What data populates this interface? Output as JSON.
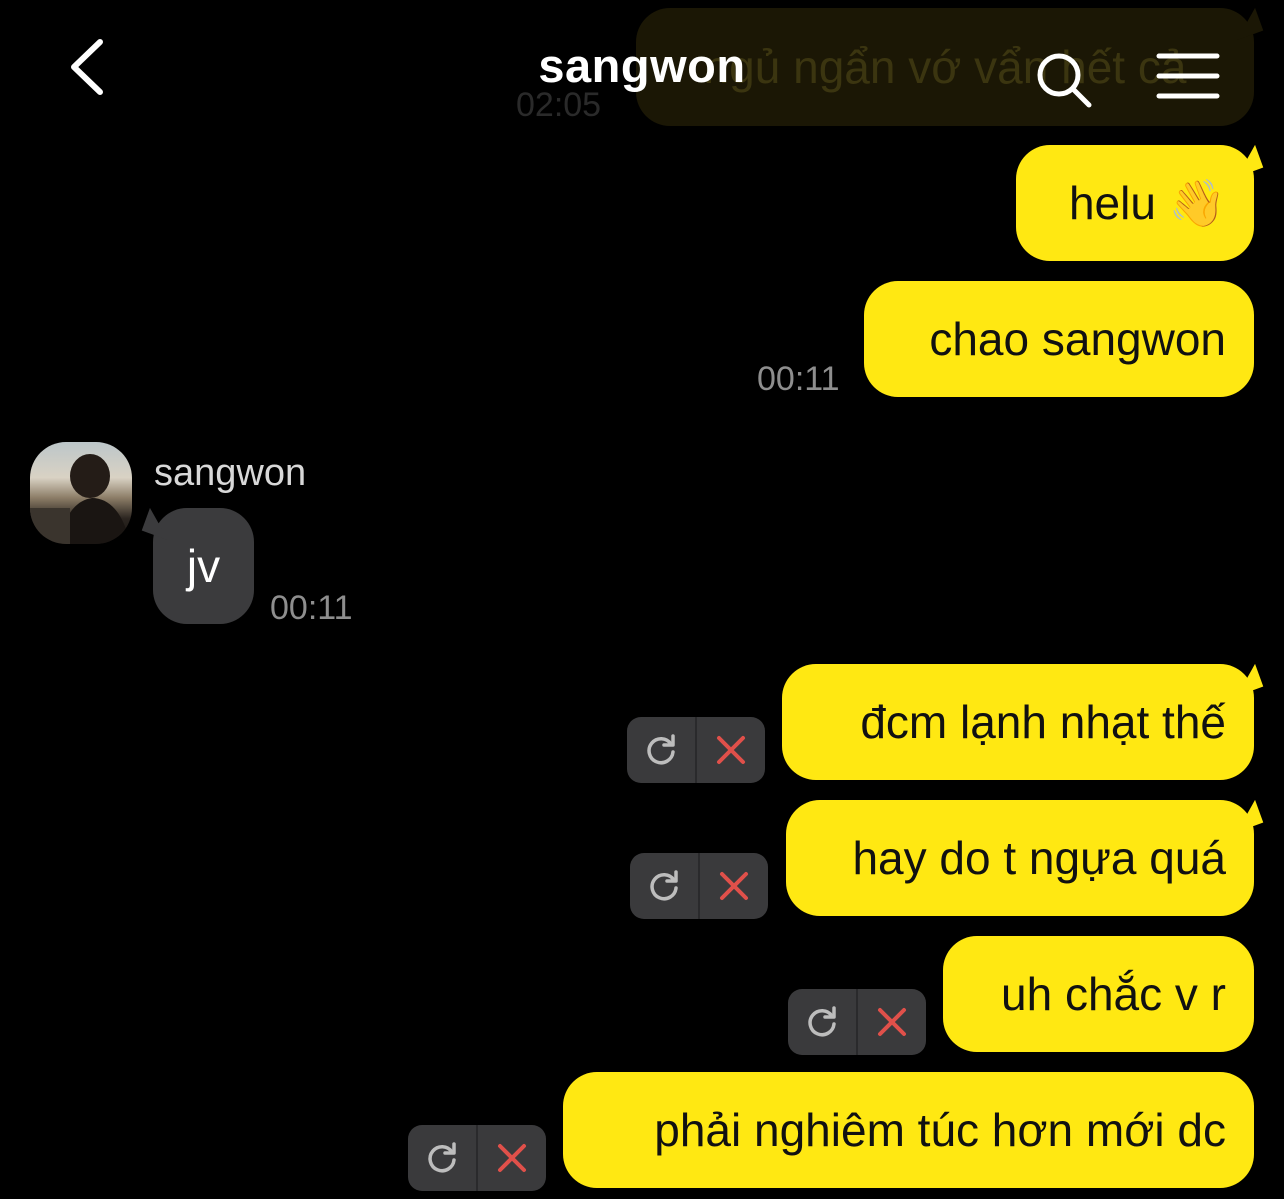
{
  "header": {
    "title": "sangwon",
    "icons": [
      "back-icon",
      "search-icon",
      "menu-icon"
    ]
  },
  "colors": {
    "outgoing_bubble": "#ffe812",
    "incoming_bubble": "#3b3b3d",
    "background": "#000000",
    "fail_x": "#e0504a"
  },
  "messages": [
    {
      "direction": "out",
      "text": "ngủ ngẩn vớ vẩn hết cả",
      "time": "02:05",
      "faded": true
    },
    {
      "direction": "out",
      "text": "helu 👋"
    },
    {
      "direction": "out",
      "text": "chao sangwon",
      "time": "00:11"
    },
    {
      "direction": "in",
      "sender": "sangwon",
      "text": "jv",
      "time": "00:11"
    },
    {
      "direction": "out",
      "text": "đcm lạnh nhạt thế",
      "failed": true
    },
    {
      "direction": "out",
      "text": "hay do t ngựa quá",
      "failed": true
    },
    {
      "direction": "out",
      "text": "uh chắc v r",
      "failed": true
    },
    {
      "direction": "out",
      "text": "phải nghiêm túc hơn mới dc",
      "failed": true
    }
  ],
  "fail_actions": {
    "icons": [
      "retry-icon",
      "delete-icon"
    ]
  }
}
